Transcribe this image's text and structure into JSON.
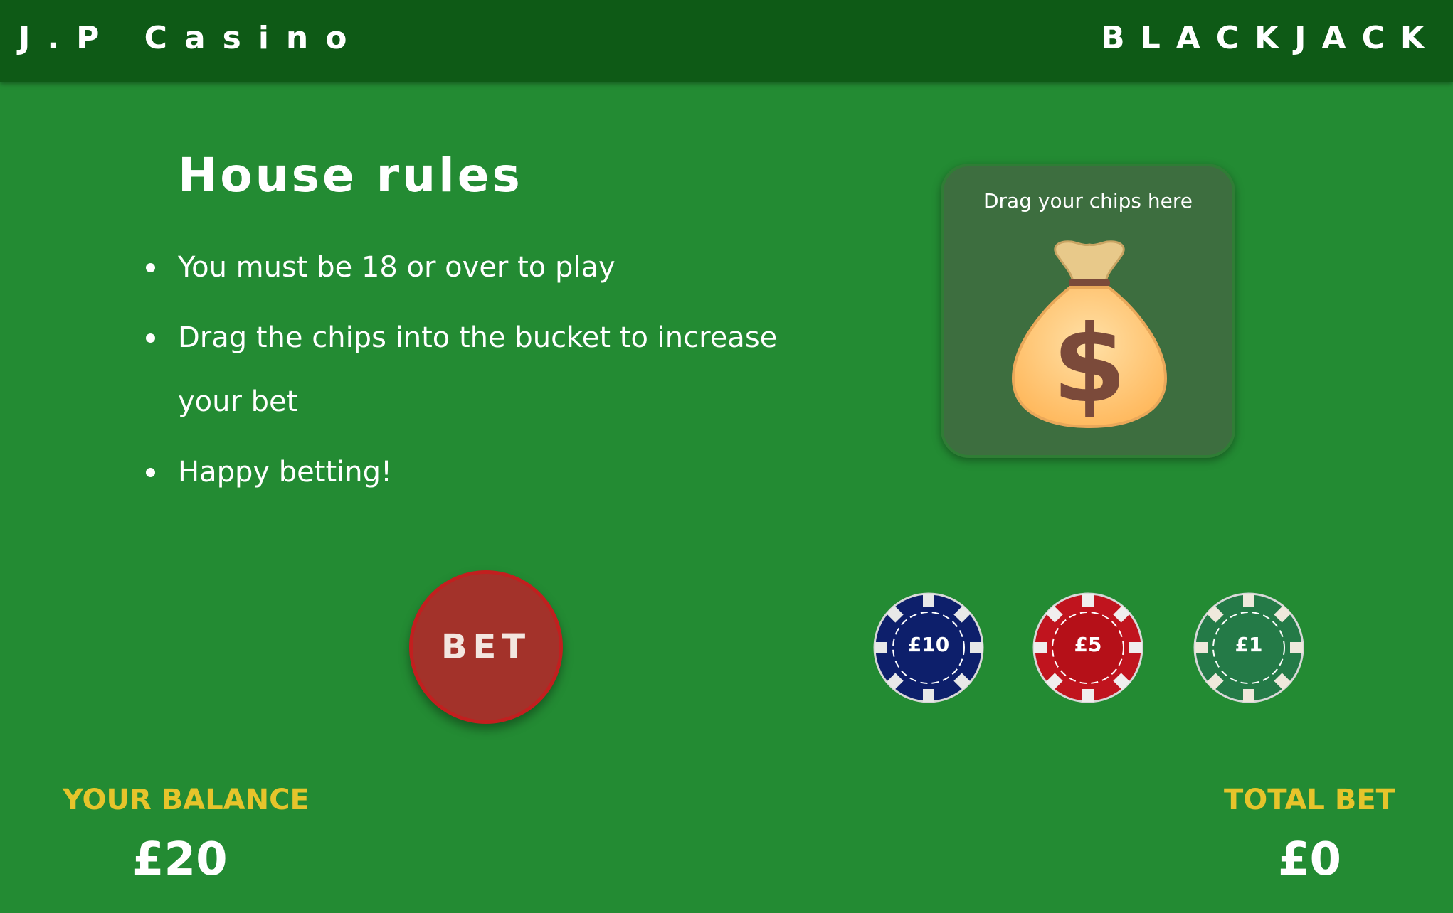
{
  "header": {
    "brand": "J.P Casino",
    "game_title": "BLACKJACK"
  },
  "rules": {
    "heading": "House rules",
    "items": [
      "You must be 18 or over to play",
      "Drag the chips into the bucket to increase your bet",
      "Happy betting!"
    ]
  },
  "dropzone": {
    "label": "Drag your chips here",
    "icon": "money-bag-icon"
  },
  "bet_button": {
    "label": "BET"
  },
  "chips": [
    {
      "label": "£10",
      "color": "#0d1f6b"
    },
    {
      "label": "£5",
      "color": "#c0141e"
    },
    {
      "label": "£1",
      "color": "#247a47"
    }
  ],
  "balance": {
    "label": "YOUR BALANCE",
    "value": "£20"
  },
  "total_bet": {
    "label": "TOTAL BET",
    "value": "£0"
  },
  "colors": {
    "felt": "#238b33",
    "header": "#0e5a16",
    "accent_yellow": "#e6c42b",
    "bet_red": "#a3322a"
  }
}
